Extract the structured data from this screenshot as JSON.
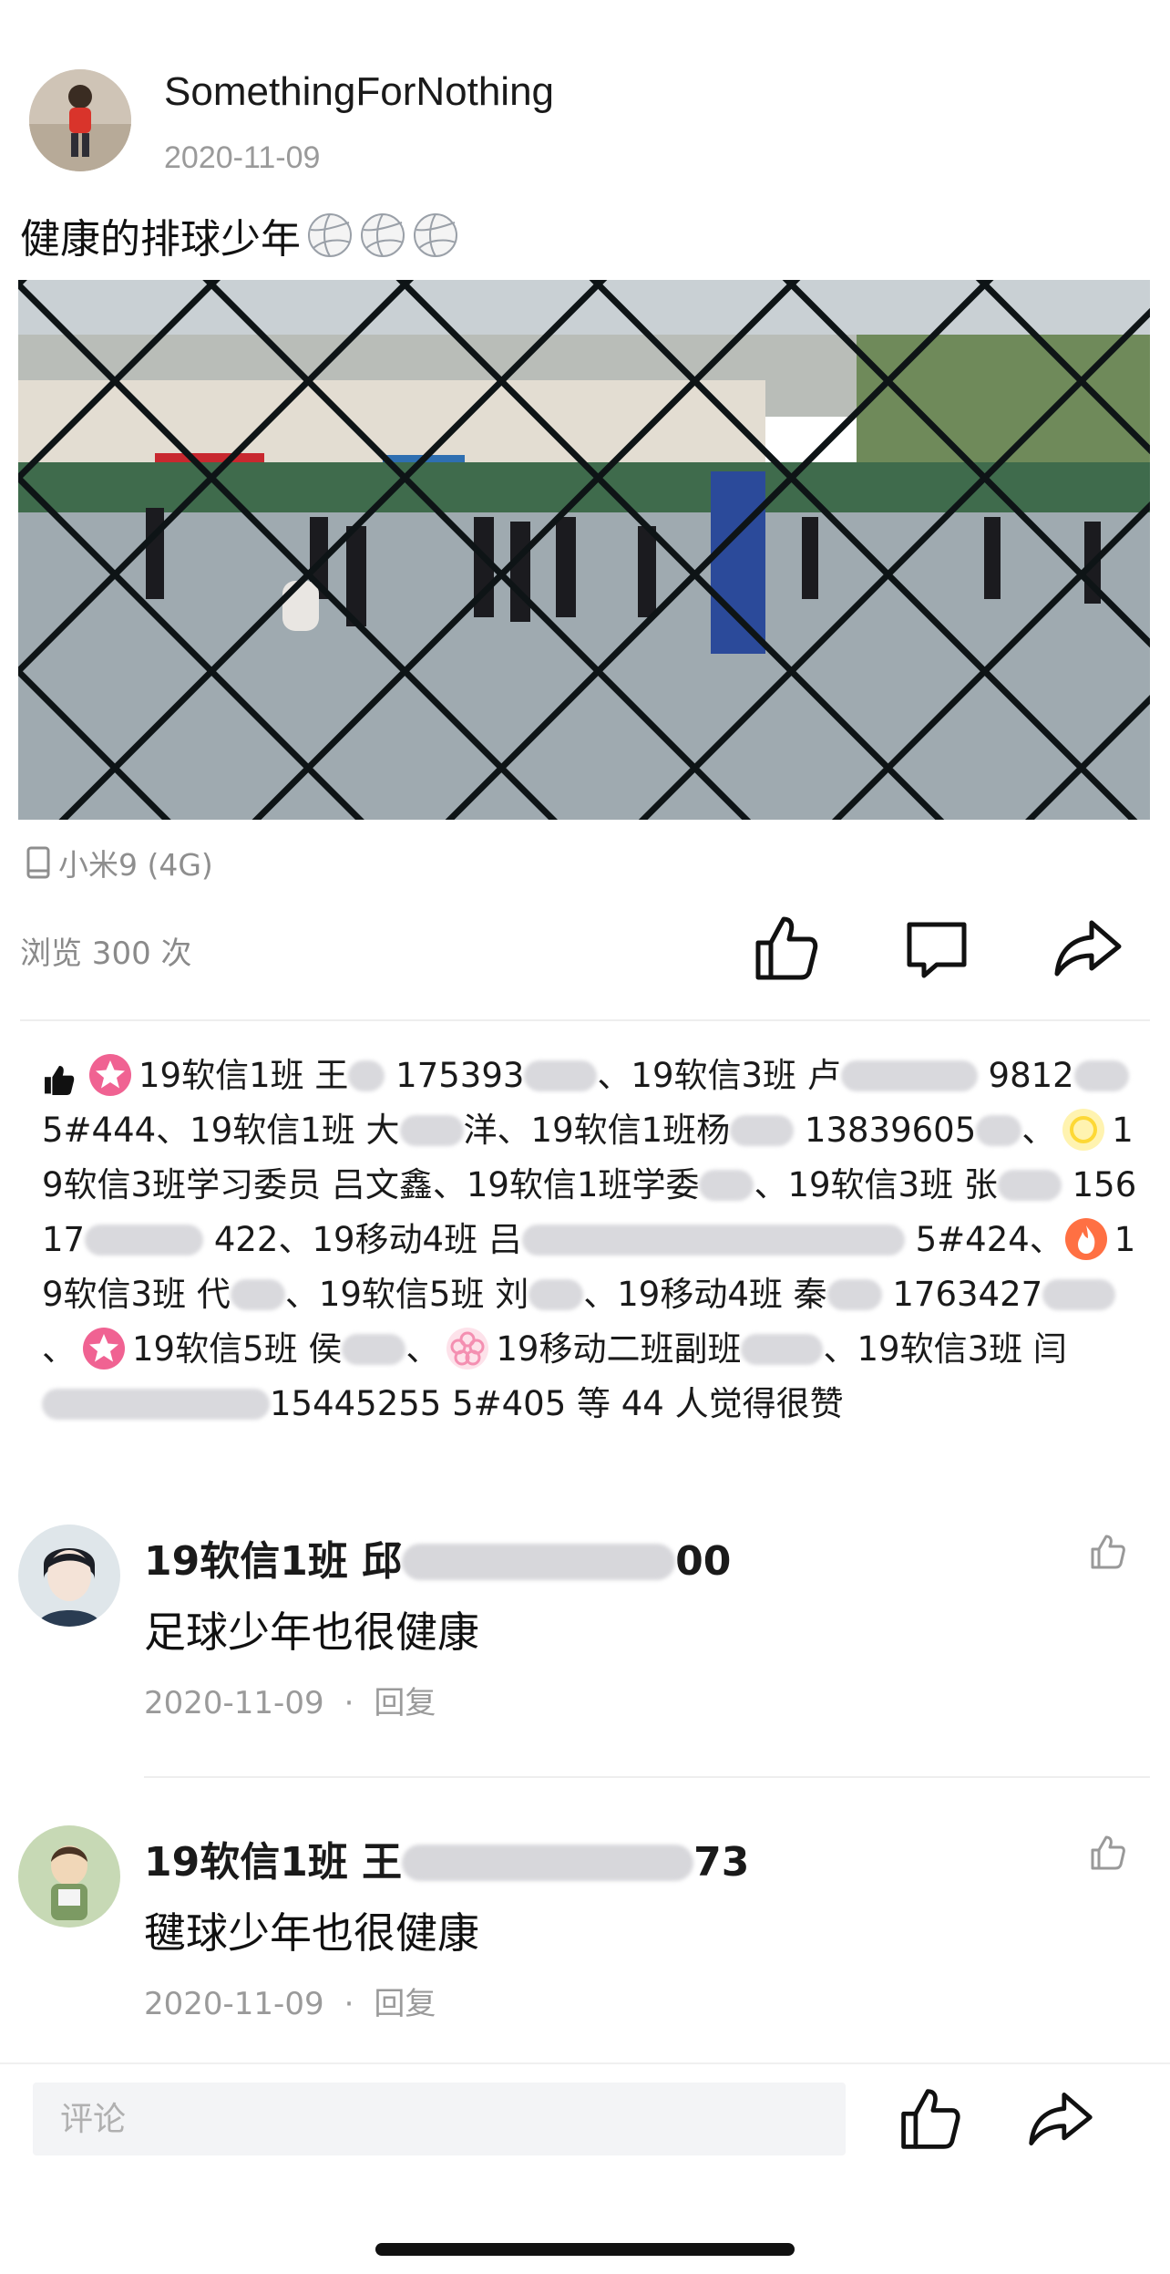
{
  "post": {
    "author": "SomethingForNothing",
    "date": "2020-11-09",
    "text": "健康的排球少年",
    "emoji_icon": "volleyball-icon",
    "emoji_count": 3,
    "device": "小米9 (4G)",
    "views": "浏览 300 次"
  },
  "likes": {
    "segments": [
      "19软信1班 王",
      " 175393",
      "、19软信3班 卢",
      " 9812",
      " 5#444、19软信1班 大",
      "洋、19软信1班杨",
      " 13839605",
      "、",
      "19软信3班学习委员 吕文鑫、19软信1班学委",
      "、19软信3班 张",
      " 15617",
      " 422、19移动4班 吕",
      " 5#424、",
      "19软信3班 代",
      "、19软信5班 刘",
      "、19移动4班 秦",
      " 1763427",
      "、",
      "19软信5班 侯",
      "、",
      "19移动二班副班",
      "、19软信3班 闫",
      "15445255 5#405 等 44 人觉得很赞"
    ]
  },
  "comments": [
    {
      "author_visible": "19软信1班 邱",
      "author_tail": "00",
      "text": "足球少年也很健康",
      "date": "2020-11-09",
      "reply": "回复"
    },
    {
      "author_visible": "19软信1班 王",
      "author_tail": "73",
      "text": "毽球少年也很健康",
      "date": "2020-11-09",
      "reply": "回复"
    }
  ],
  "bottom": {
    "comment_placeholder": "评论"
  },
  "colors": {
    "meta_gray": "#9a9a9a",
    "divider": "#eeeeee",
    "input_bg": "#f3f4f6",
    "badge_pink": "#f06292",
    "badge_yellow": "#fdd835",
    "badge_orange": "#ff7043"
  }
}
